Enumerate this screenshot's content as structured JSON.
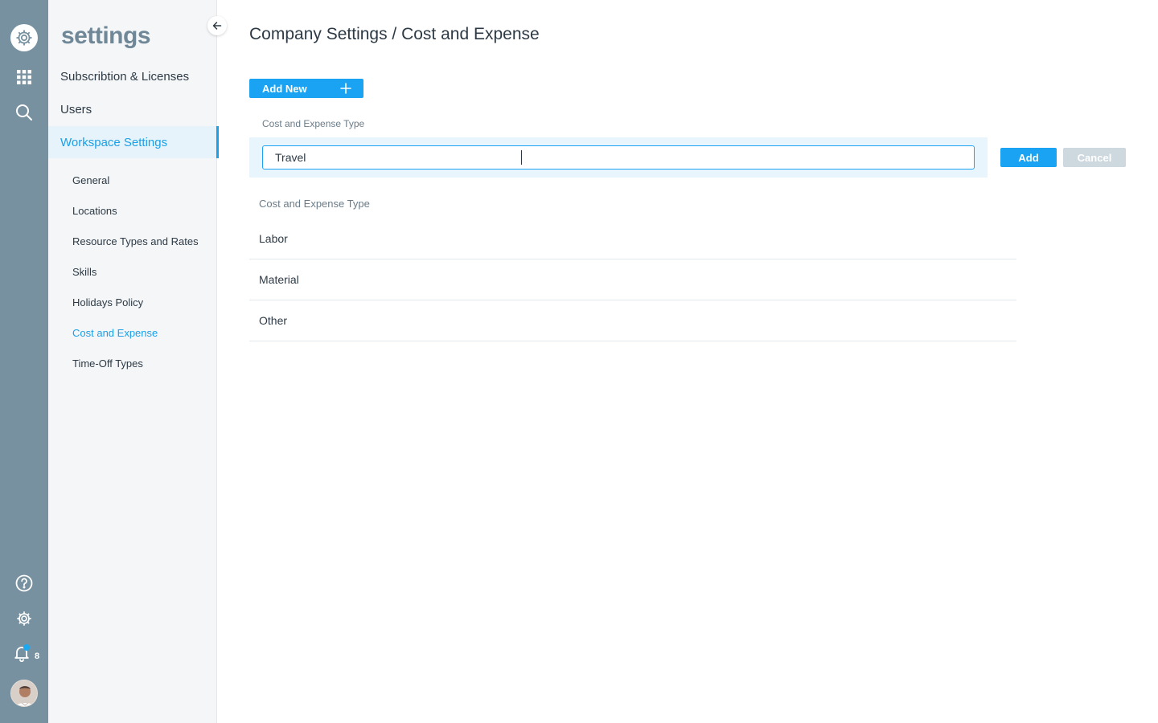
{
  "rail": {
    "badge_count": "8"
  },
  "sidebar": {
    "brand": "settings",
    "top_items": [
      {
        "label": "Subscribtion & Licenses"
      },
      {
        "label": "Users"
      },
      {
        "label": "Workspace Settings"
      }
    ],
    "sub_items": [
      {
        "label": "General"
      },
      {
        "label": "Locations"
      },
      {
        "label": "Resource Types and Rates"
      },
      {
        "label": "Skills"
      },
      {
        "label": "Holidays Policy"
      },
      {
        "label": "Cost and Expense"
      },
      {
        "label": "Time-Off Types"
      }
    ]
  },
  "main": {
    "title": "Company Settings / Cost and Expense",
    "add_new_label": "Add New",
    "form": {
      "label": "Cost and Expense Type",
      "value": "Travel",
      "add_label": "Add",
      "cancel_label": "Cancel"
    },
    "list": {
      "header": "Cost and Expense Type",
      "rows": [
        {
          "label": "Labor"
        },
        {
          "label": "Material"
        },
        {
          "label": "Other"
        }
      ]
    }
  },
  "colors": {
    "accent": "#1aa3f2",
    "rail": "#7791a0",
    "sidebar_bg": "#f4f6f8",
    "active_bg": "#e6f3fb",
    "form_band": "#e8f5fd",
    "cancel_disabled": "#cdd8df"
  }
}
